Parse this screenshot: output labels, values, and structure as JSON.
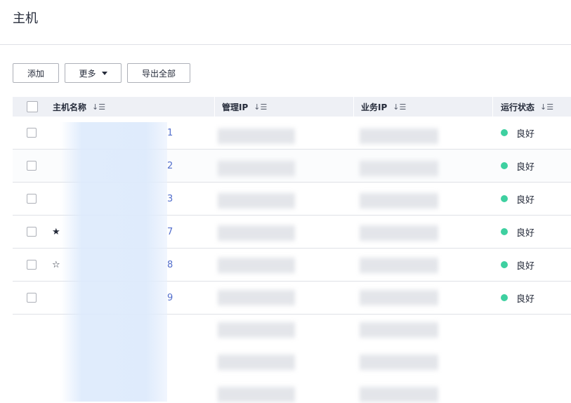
{
  "page": {
    "title": "主机"
  },
  "toolbar": {
    "add_label": "添加",
    "more_label": "更多",
    "export_label": "导出全部"
  },
  "table": {
    "columns": {
      "name": "主机名称",
      "mgmt_ip": "管理IP",
      "biz_ip": "业务IP",
      "status": "运行状态"
    },
    "sort_icon": "↓☰",
    "rows": [
      {
        "star": "",
        "name_suffix": "1",
        "status": "良好"
      },
      {
        "star": "",
        "name_suffix": "2",
        "status": "良好"
      },
      {
        "star": "",
        "name_suffix": "3",
        "status": "良好"
      },
      {
        "star": "★",
        "name_suffix": "7",
        "status": "良好"
      },
      {
        "star": "☆",
        "name_suffix": "8",
        "status": "良好"
      },
      {
        "star": "",
        "name_suffix": "9",
        "status": "良好"
      }
    ]
  },
  "colors": {
    "status_good": "#3ed0a0",
    "link": "#526ecc",
    "header_bg": "#eef0f5"
  }
}
